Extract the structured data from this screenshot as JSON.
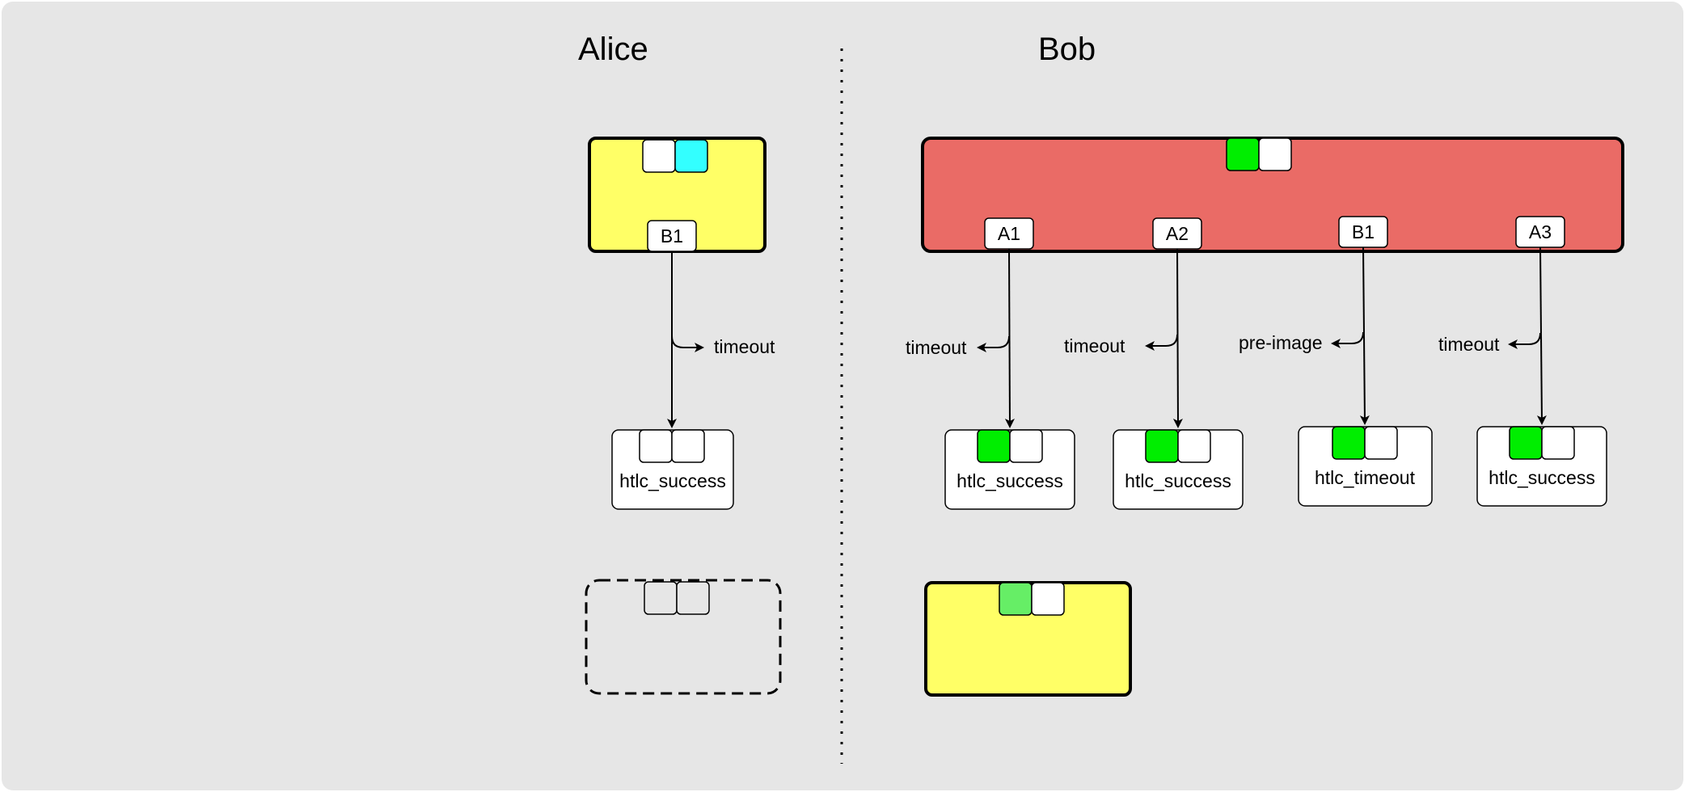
{
  "parties": {
    "alice": "Alice",
    "bob": "Bob"
  },
  "alice": {
    "output": "B1",
    "arrow_label": "timeout",
    "tx_label": "htlc_success"
  },
  "bob": {
    "outputs": [
      "A1",
      "A2",
      "B1",
      "A3"
    ],
    "arrow_labels": [
      "timeout",
      "timeout",
      "pre-image",
      "timeout"
    ],
    "tx_labels": [
      "htlc_success",
      "htlc_success",
      "htlc_timeout",
      "htlc_success"
    ]
  },
  "colors": {
    "background": "#e6e6e6",
    "yellow_tx": "#ffff66",
    "red_tx": "#ea6b66",
    "green_key": "#00ee00",
    "light_green_key": "#66ee66",
    "cyan_key": "#33ffff",
    "white": "#ffffff"
  }
}
